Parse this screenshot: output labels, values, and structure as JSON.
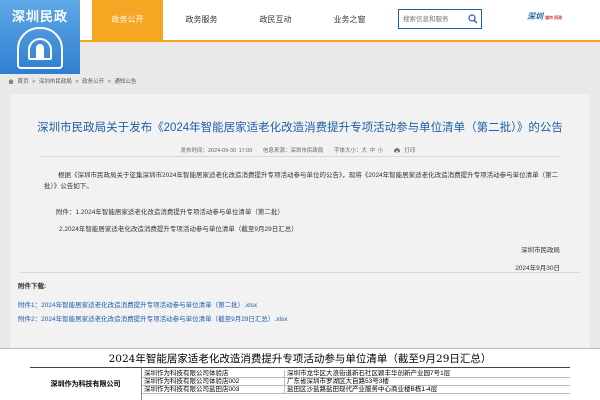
{
  "header": {
    "logo_text": "深圳民政",
    "nav": [
      {
        "label": "政务公开",
        "active": true
      },
      {
        "label": "政务服务",
        "active": false
      },
      {
        "label": "政民互动",
        "active": false
      },
      {
        "label": "业务之窗",
        "active": false
      }
    ],
    "search_placeholder": "搜索信息和服务",
    "brand": "深圳",
    "brand_sub": "城市 民政"
  },
  "breadcrumb": [
    "首页",
    ">",
    "深圳市民政局",
    ">",
    "政务公开",
    ">",
    "通知公告"
  ],
  "article": {
    "title": "深圳市民政局关于发布《2024年智能居家适老化改造消费提升专项活动参与单位清单（第二批）》的公告",
    "meta_date": "发布时间：2024-09-30 17:00",
    "meta_source": "信息来源：深圳市民政局",
    "meta_font": "字体大小：大 中 小",
    "meta_print": "打印",
    "paragraph": "根据《深圳市民政局关于征集深圳市2024年智能居家适老化改造消费提升专项活动参与单位的公告》，现将《2024年智能居家适老化改造消费提升专项活动参与单位清单（第二批）》公告如下。",
    "attach_1": "附件：1.2024年智能居家适老化改造消费提升专项活动参与单位清单（第二批）",
    "attach_2": "2.2024年智能居家适老化改造消费提升专项活动参与单位清单（截至9月29日汇总）",
    "sign_org": "深圳市民政局",
    "sign_date": "2024年9月30日"
  },
  "downloads": {
    "title": "附件下载:",
    "link_1": "附件1：2024年智能居家适老化改造消费提升专项活动参与单位清单（第二批）.xlsx",
    "link_2": "附件2：2024年智能居家适老化改造消费提升专项活动参与单位清单（截至9月29日汇总）.xlsx"
  },
  "sheet": {
    "title": "2024年智能居家适老化改造消费提升专项活动参与单位清单（截至9月29日汇总）",
    "org": "深圳作为科技有限公司",
    "rows": [
      {
        "store": "深圳作为科技有限公司体验店",
        "address": "深圳市龙华区大浪街道新石社区颖丰华创新产业园7号1层"
      },
      {
        "store": "深圳作为科技有限公司体验店002",
        "address": "广东省深圳市罗湖区大自路53号3楼"
      },
      {
        "store": "深圳作为科技有限公司盐田店003",
        "address": "盐田区沙盐路盐田现代产业服务中心商业楼B栋1-4层"
      }
    ]
  },
  "colors": {
    "accent": "#f5a623",
    "link": "#1d5fa8",
    "logo": "#2f7fd2"
  }
}
